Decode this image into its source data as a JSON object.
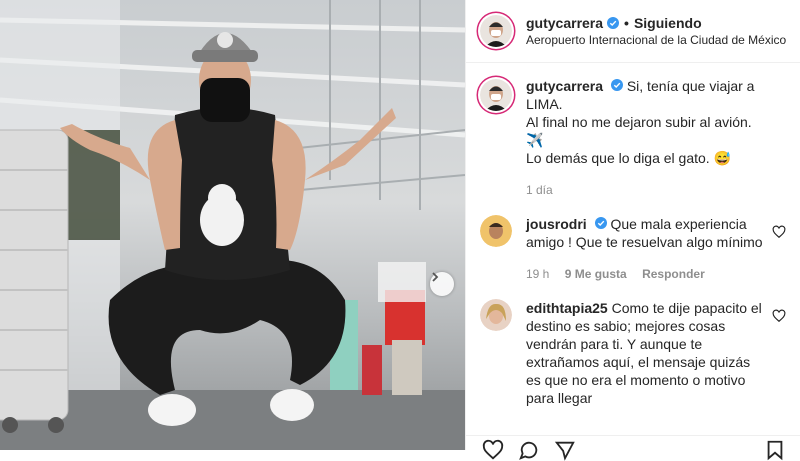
{
  "post": {
    "username": "gutycarrera",
    "separator": "•",
    "follow_status": "Siguiendo",
    "location": "Aeropuerto Internacional de la Ciudad de México"
  },
  "caption": {
    "username": "gutycarrera",
    "line1": "Si, tenía que viajar a",
    "line2": "LIMA.",
    "line3": "Al final no me dejaron subir al avión.",
    "line4_emoji": "✈️",
    "line5": "Lo demás que lo diga el gato. 😅",
    "time": "1 día"
  },
  "comments": [
    {
      "username": "jousrodri",
      "verified": true,
      "text": "Que mala experiencia amigo ! Que te resuelvan algo mínimo",
      "time": "19 h",
      "likes": "9 Me gusta",
      "reply": "Responder"
    },
    {
      "username": "edithtapia25",
      "verified": false,
      "text": "Como te dije papacito el destino es sabio; mejores cosas vendrán para ti. Y aunque te extrañamos aquí, el mensaje quizás es que no era el momento o motivo para llegar"
    }
  ],
  "icons": {
    "verified": "verified-badge-icon",
    "next": "chevron-right-icon",
    "heart": "heart-outline-icon",
    "like": "heart-icon",
    "comment": "comment-icon",
    "share": "share-icon",
    "save": "bookmark-icon"
  },
  "colors": {
    "verified_blue": "#3897f0",
    "story_ring": "#d62976",
    "meta_gray": "#8e8e8e"
  }
}
